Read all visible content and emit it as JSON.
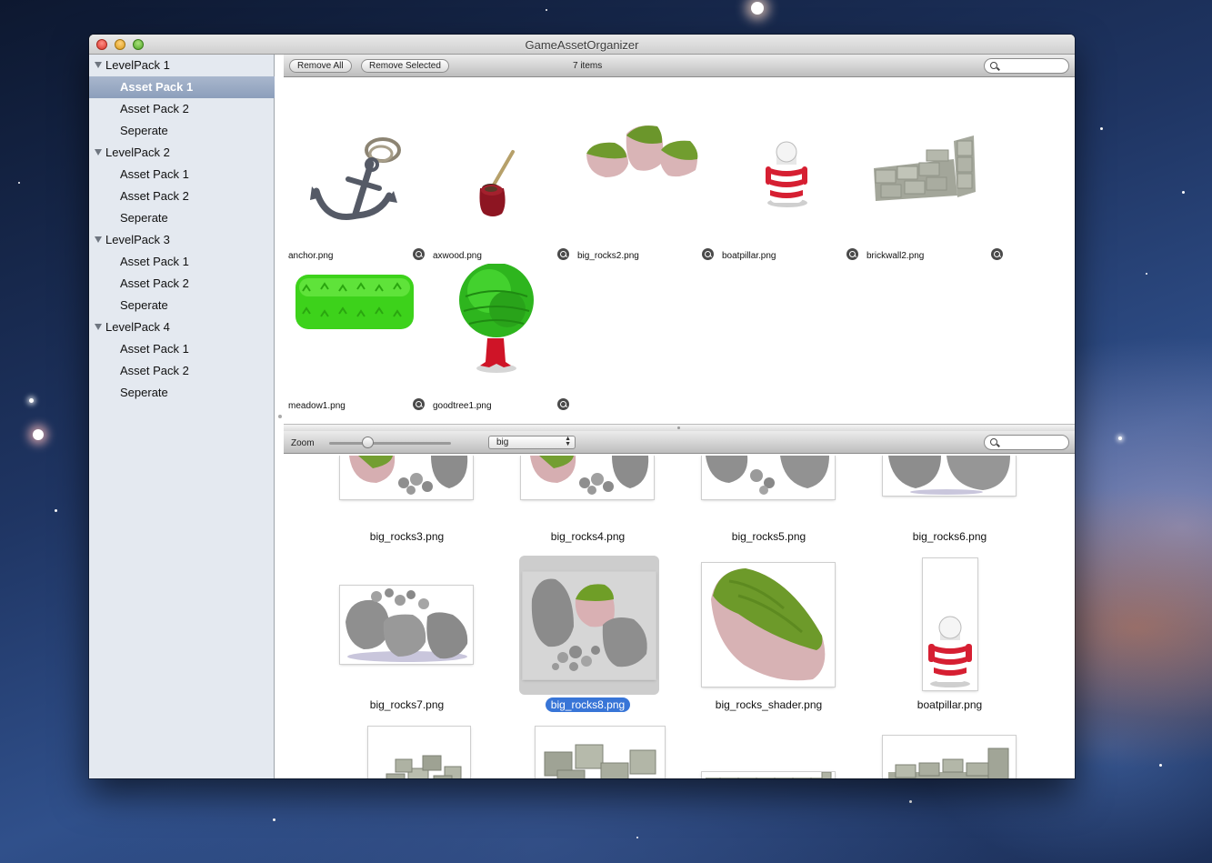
{
  "window": {
    "title": "GameAssetOrganizer"
  },
  "sidebar": {
    "groups": [
      {
        "label": "LevelPack 1",
        "items": [
          {
            "label": "Asset Pack 1",
            "selected": true
          },
          {
            "label": "Asset Pack 2"
          },
          {
            "label": "Seperate"
          }
        ]
      },
      {
        "label": "LevelPack 2",
        "items": [
          {
            "label": "Asset Pack 1"
          },
          {
            "label": "Asset Pack 2"
          },
          {
            "label": "Seperate"
          }
        ]
      },
      {
        "label": "LevelPack 3",
        "items": [
          {
            "label": "Asset Pack 1"
          },
          {
            "label": "Asset Pack 2"
          },
          {
            "label": "Seperate"
          }
        ]
      },
      {
        "label": "LevelPack 4",
        "items": [
          {
            "label": "Asset Pack 1"
          },
          {
            "label": "Asset Pack 2"
          },
          {
            "label": "Seperate"
          }
        ]
      }
    ]
  },
  "top_toolbar": {
    "remove_all": "Remove All",
    "remove_selected": "Remove Selected",
    "item_count": "7 items",
    "search_icon": "search-icon"
  },
  "top_items": [
    {
      "name": "anchor.png",
      "icon": "anchor"
    },
    {
      "name": "axwood.png",
      "icon": "axwood"
    },
    {
      "name": "big_rocks2.png",
      "icon": "mossy-rocks"
    },
    {
      "name": "boatpillar.png",
      "icon": "boatpillar"
    },
    {
      "name": "brickwall2.png",
      "icon": "brickwall"
    },
    {
      "name": "meadow1.png",
      "icon": "meadow"
    },
    {
      "name": "goodtree1.png",
      "icon": "tree"
    }
  ],
  "bottom_toolbar": {
    "zoom_label": "Zoom",
    "zoom_level": 0.3,
    "size_select": "big",
    "search_icon": "search-icon"
  },
  "bottom_items": [
    {
      "name": "big_rocks3.png",
      "icon": "rocks-partial"
    },
    {
      "name": "big_rocks4.png",
      "icon": "rocks-partial"
    },
    {
      "name": "big_rocks5.png",
      "icon": "rocks-partial"
    },
    {
      "name": "big_rocks6.png",
      "icon": "rocks-partial"
    },
    {
      "name": "big_rocks7.png",
      "icon": "grey-rocks"
    },
    {
      "name": "big_rocks8.png",
      "icon": "mixed-rocks",
      "selected": true
    },
    {
      "name": "big_rocks_shader.png",
      "icon": "mossy-rock"
    },
    {
      "name": "boatpillar.png",
      "icon": "boatpillar"
    },
    {
      "name": "",
      "icon": "stone-pile-small"
    },
    {
      "name": "",
      "icon": "stone-pile"
    },
    {
      "name": "",
      "icon": "stone-wall-low"
    },
    {
      "name": "",
      "icon": "stone-wall"
    }
  ],
  "colors": {
    "selection": "#3875d7",
    "sidebar_bg": "#e4e9f0",
    "sidebar_selected": "#8c9fbb"
  }
}
